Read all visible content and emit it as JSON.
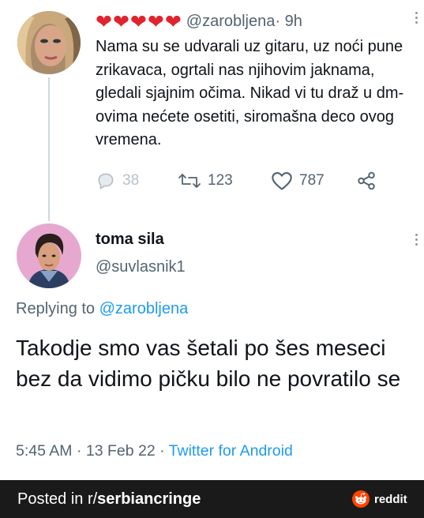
{
  "tweet1": {
    "hearts": [
      "❤",
      "❤",
      "❤",
      "❤",
      "❤"
    ],
    "handle": "@zarobljena",
    "time": " · 9h",
    "text": "Nama su se udvarali uz gitaru, uz noći pune zrikavaca, ogrtali nas njihovim jaknama, gledali sjajnim očima. Nikad vi tu draž u dm- ovima nećete osetiti, siromašna deco ovog vremena.",
    "replies": "38",
    "retweets": "123",
    "likes": "787"
  },
  "tweet2": {
    "name": "toma sila",
    "handle": "@suvlasnik1",
    "replying_prefix": "Replying to ",
    "replying_to": "@zarobljena",
    "text": "Takodje smo vas šetali po šes meseci bez da vidimo pičku bilo ne povratilo se",
    "timestamp": "5:45 AM · 13 Feb 22 · ",
    "source": "Twitter for Android"
  },
  "footer": {
    "posted_prefix": "Posted in r/",
    "subreddit": "serbiancringe",
    "brand": "reddit"
  },
  "colors": {
    "accent": "#1d9bf0",
    "secondary_text": "#536471",
    "heart": "#e0242e",
    "footer_bg": "#1a1a1b",
    "reddit_orange": "#ff4500"
  }
}
